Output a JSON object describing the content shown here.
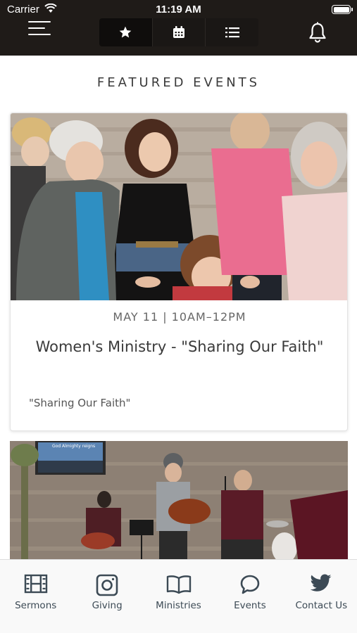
{
  "status_bar": {
    "carrier": "Carrier",
    "time": "11:19 AM"
  },
  "header": {
    "menu_icon": "hamburger-icon",
    "segments": [
      {
        "icon": "star-icon",
        "active": true
      },
      {
        "icon": "calendar-icon",
        "active": false
      },
      {
        "icon": "list-icon",
        "active": false
      }
    ],
    "notification_icon": "bell-icon"
  },
  "main": {
    "section_title": "FEATURED EVENTS",
    "events": [
      {
        "date": "MAY 11 | 10AM–12PM",
        "title": "Women's Ministry - \"Sharing Our Faith\"",
        "subtitle": "\"Sharing Our Faith\""
      },
      {
        "banner_text": "God Almighty reigns"
      }
    ]
  },
  "tabbar": {
    "tabs": [
      {
        "label": "Sermons",
        "icon": "film-icon"
      },
      {
        "label": "Giving",
        "icon": "giving-icon"
      },
      {
        "label": "Ministries",
        "icon": "book-icon"
      },
      {
        "label": "Events",
        "icon": "chat-bubble-icon"
      },
      {
        "label": "Contact Us",
        "icon": "twitter-bird-icon"
      }
    ]
  },
  "colors": {
    "header_bg": "#1f1b18",
    "tab_icon": "#3c4a55",
    "title_text": "#3a3a3a"
  }
}
